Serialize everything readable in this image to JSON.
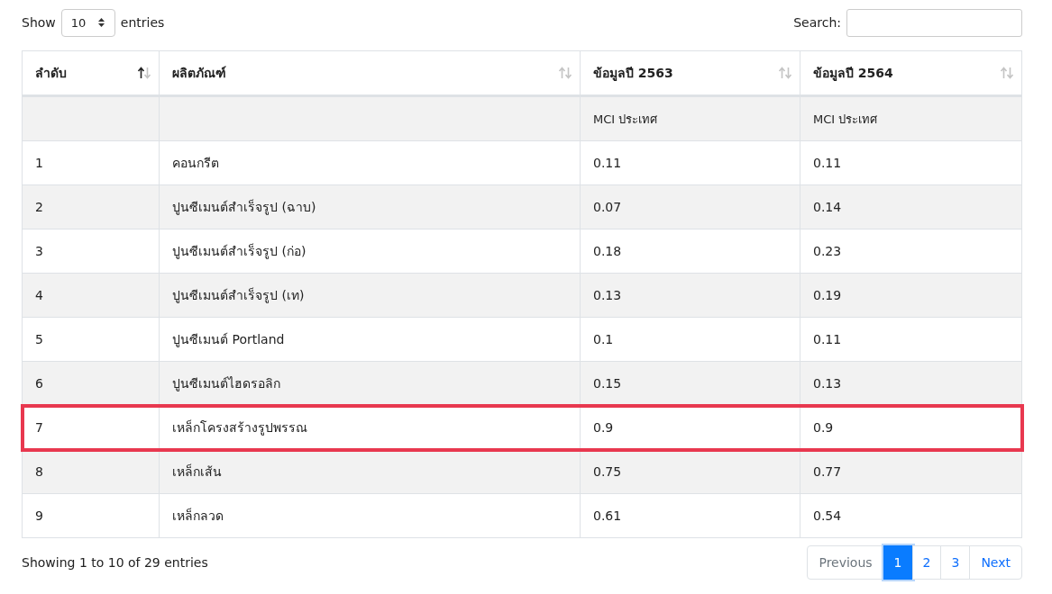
{
  "length_control": {
    "label_before": "Show",
    "value": "10",
    "label_after": "entries"
  },
  "search": {
    "label": "Search:"
  },
  "table": {
    "columns": [
      {
        "label": "ลำดับ",
        "sorted_ascending": true
      },
      {
        "label": "ผลิตภัณฑ์",
        "sorted_ascending": false
      },
      {
        "label": "ข้อมูลปี 2563",
        "sorted_ascending": false,
        "subheader": "MCI ประเทศ"
      },
      {
        "label": "ข้อมูลปี 2564",
        "sorted_ascending": false,
        "subheader": "MCI ประเทศ"
      }
    ],
    "rows": [
      {
        "cells": [
          "1",
          "คอนกรีต",
          "0.11",
          "0.11"
        ],
        "highlighted": false
      },
      {
        "cells": [
          "2",
          "ปูนซีเมนต์สำเร็จรูป (ฉาบ)",
          "0.07",
          "0.14"
        ],
        "highlighted": false
      },
      {
        "cells": [
          "3",
          "ปูนซีเมนต์สำเร็จรูป (ก่อ)",
          "0.18",
          "0.23"
        ],
        "highlighted": false
      },
      {
        "cells": [
          "4",
          "ปูนซีเมนต์สำเร็จรูป (เท)",
          "0.13",
          "0.19"
        ],
        "highlighted": false
      },
      {
        "cells": [
          "5",
          "ปูนซีเมนต์ Portland",
          "0.1",
          "0.11"
        ],
        "highlighted": false
      },
      {
        "cells": [
          "6",
          "ปูนซีเมนต์ไฮดรอลิก",
          "0.15",
          "0.13"
        ],
        "highlighted": false
      },
      {
        "cells": [
          "7",
          "เหล็กโครงสร้างรูปพรรณ",
          "0.9",
          "0.9"
        ],
        "highlighted": true
      },
      {
        "cells": [
          "8",
          "เหล็กเส้น",
          "0.75",
          "0.77"
        ],
        "highlighted": false
      },
      {
        "cells": [
          "9",
          "เหล็กลวด",
          "0.61",
          "0.54"
        ],
        "highlighted": false
      }
    ]
  },
  "info": "Showing 1 to 10 of 29 entries",
  "pagination": [
    {
      "label": "Previous",
      "kind": "nav",
      "disabled": true,
      "selected": false
    },
    {
      "label": "1",
      "kind": "page",
      "disabled": false,
      "selected": true
    },
    {
      "label": "2",
      "kind": "page",
      "disabled": false,
      "selected": false
    },
    {
      "label": "3",
      "kind": "page",
      "disabled": false,
      "selected": false
    },
    {
      "label": "Next",
      "kind": "nav",
      "disabled": false,
      "selected": false
    }
  ]
}
